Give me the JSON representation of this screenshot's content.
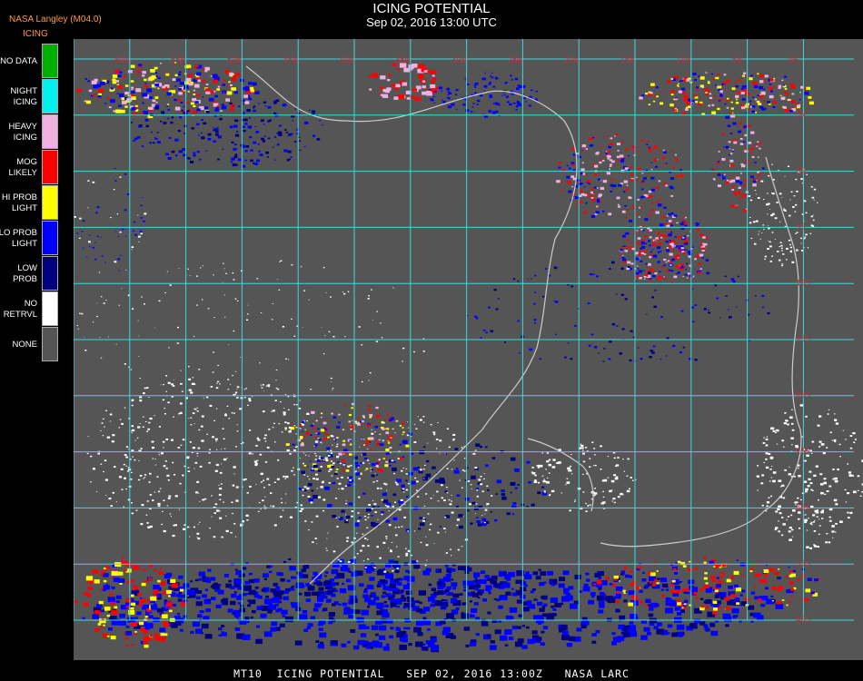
{
  "header": {
    "title": "ICING POTENTIAL",
    "datetime": "Sep 02, 2016 13:00 UTC",
    "source": "NASA Langley (M04.0)",
    "legend_title": "ICING"
  },
  "legend": [
    {
      "label": "NO DATA",
      "color": "#00b000"
    },
    {
      "label": "NIGHT\nICING",
      "color": "#00f0f0"
    },
    {
      "label": "HEAVY\nICING",
      "color": "#f0b0e0"
    },
    {
      "label": "MOG\nLIKELY",
      "color": "#ff0000"
    },
    {
      "label": "HI PROB\nLIGHT",
      "color": "#ffff00"
    },
    {
      "label": "LO PROB\nLIGHT",
      "color": "#0000ff"
    },
    {
      "label": "LOW\nPROB",
      "color": "#000080"
    },
    {
      "label": "NO\nRETRVL",
      "color": "#ffffff"
    },
    {
      "label": "NONE",
      "color": "#555555"
    }
  ],
  "map": {
    "background": "#555555",
    "grid_color": "#3fd8e0",
    "coast_color": "#cccccc",
    "lon_labels": [
      "60W",
      "55W",
      "50W",
      "45W",
      "40W",
      "35W",
      "30W",
      "25W",
      "20W",
      "15W",
      "10W",
      "5W",
      "0E"
    ],
    "lat_labels": [
      "5N",
      "0N",
      "5S",
      "10S",
      "15S",
      "20S",
      "25S",
      "30S",
      "35S",
      "40S"
    ],
    "label_color": "#c0303a"
  },
  "footer": "MT10  ICING POTENTIAL   SEP 02, 2016 13:00Z   NASA LARC"
}
